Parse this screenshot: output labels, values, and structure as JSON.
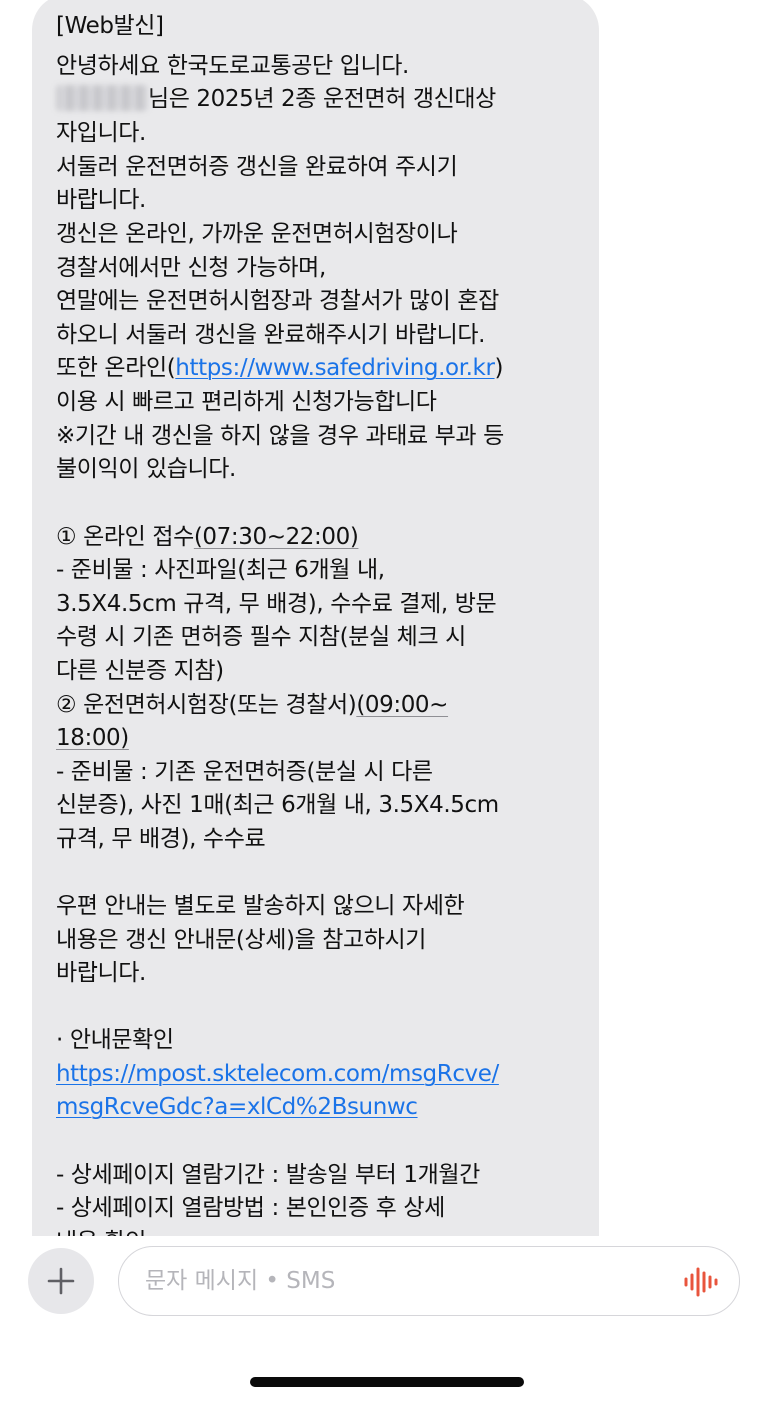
{
  "message": {
    "header": "[Web발신]",
    "greeting": "안녕하세요 한국도로교통공단 입니다.",
    "target_line": "님은 2025년 2종 운전면허 갱신대상",
    "line_04": "자입니다.",
    "line_05": "서둘러 운전면허증 갱신을 완료하여 주시기",
    "line_06": "바랍니다.",
    "line_07": "갱신은 온라인, 가까운 운전면허시험장이나",
    "line_08": "경찰서에서만 신청 가능하며,",
    "line_09": "연말에는 운전면허시험장과 경찰서가 많이 혼잡",
    "line_10": "하오니 서둘러 갱신을 완료해주시기 바랍니다.",
    "online_prefix": "또한 온라인(",
    "online_link": "https://www.safedriving.or.kr",
    "online_suffix": ")",
    "line_12": "이용 시 빠르고 편리하게 신청가능합니다",
    "line_13": "※기간 내 갱신을 하지 않을 경우 과태료 부과 등",
    "line_14": "불이익이 있습니다.",
    "s1_prefix": "① 온라인 접수",
    "s1_hours": "(07:30~22:00)",
    "s1_line_2": "- 준비물 : 사진파일(최근 6개월 내,",
    "s1_line_3": "3.5X4.5cm 규격, 무 배경), 수수료 결제, 방문",
    "s1_line_4": "수령 시 기존 면허증 필수 지참(분실 체크 시",
    "s1_line_5": "다른 신분증 지참)",
    "s2_prefix": "② 운전면허시험장(또는 경찰서)",
    "s2_hours_a": "(09:00~",
    "s2_hours_b": "18:00)",
    "s2_line_3": "- 준비물 : 기존 운전면허증(분실 시 다른",
    "s2_line_4": "신분증), 사진 1매(최근 6개월 내, 3.5X4.5cm",
    "s2_line_5": "규격, 무 배경), 수수료",
    "mail_line_1": "우편 안내는 별도로 발송하지 않으니 자세한",
    "mail_line_2": "내용은 갱신 안내문(상세)을 참고하시기",
    "mail_line_3": "바랍니다.",
    "notice_title": "· 안내문확인",
    "notice_link_1": "https://mpost.sktelecom.com/msgRcve/",
    "notice_link_2": "msgRcveGdc?a=xlCd%2Bsunwc",
    "detail_line_1": "- 상세페이지 열람기간 : 발송일 부터 1개월간",
    "detail_line_2": "- 상세페이지 열람방법 : 본인인증 후 상세",
    "detail_line_3": "내용 확인"
  },
  "composer": {
    "placeholder": "문자 메시지 • SMS",
    "plus_icon": "plus-icon",
    "voice_icon": "waveform-icon",
    "voice_color": "#e8553d"
  }
}
